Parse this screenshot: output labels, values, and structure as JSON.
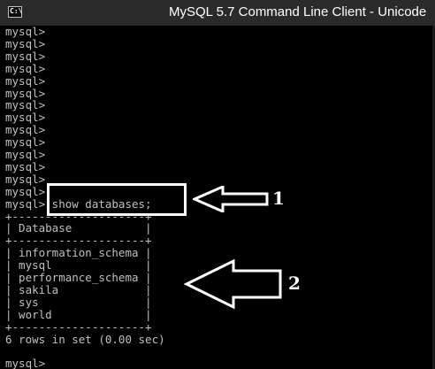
{
  "window": {
    "title": "MySQL 5.7 Command Line Client - Unicode",
    "icon_text": "C:\\"
  },
  "console": {
    "lines": [
      "mysql>",
      "mysql>",
      "mysql>",
      "mysql>",
      "mysql>",
      "mysql>",
      "mysql>",
      "mysql>",
      "mysql>",
      "mysql>",
      "mysql>",
      "mysql>",
      "mysql>",
      "mysql>",
      "mysql> show databases;",
      "+--------------------+",
      "| Database           |",
      "+--------------------+",
      "| information_schema |",
      "| mysql              |",
      "| performance_schema |",
      "| sakila             |",
      "| sys                |",
      "| world              |",
      "+--------------------+",
      "6 rows in set (0.00 sec)",
      "",
      "mysql>"
    ]
  },
  "annotations": {
    "label_1": "1",
    "label_2": "2",
    "color": "#ffffff"
  }
}
